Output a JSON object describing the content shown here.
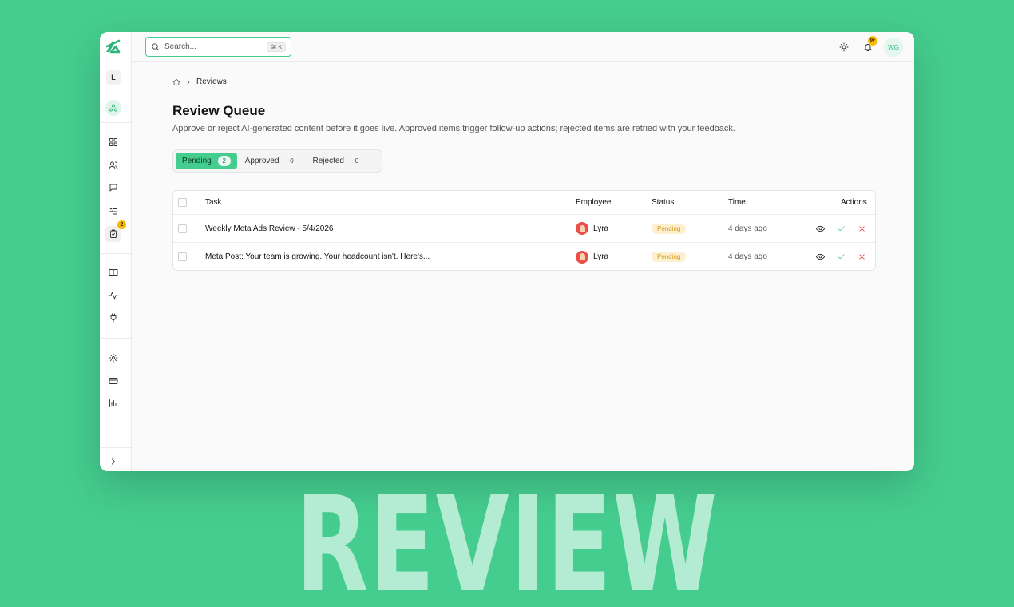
{
  "search": {
    "placeholder": "Search...",
    "shortcut": "⌘ K"
  },
  "workspace": {
    "initial": "L"
  },
  "topbar": {
    "notification_badge": "9+",
    "user_initials": "WG"
  },
  "sidebar": {
    "reviews_badge": "2",
    "icons": [
      "agents-icon",
      "dashboard-icon",
      "users-icon",
      "chat-icon",
      "tasks-icon",
      "reviews-icon",
      "book-icon",
      "activity-icon",
      "plug-icon",
      "settings-icon",
      "billing-icon",
      "analytics-icon",
      "expand-icon"
    ]
  },
  "breadcrumb": {
    "current": "Reviews"
  },
  "page": {
    "title": "Review Queue",
    "description": "Approve or reject AI-generated content before it goes live. Approved items trigger follow-up actions; rejected items are retried with your feedback."
  },
  "tabs": [
    {
      "label": "Pending",
      "count": "2"
    },
    {
      "label": "Approved",
      "count": "0"
    },
    {
      "label": "Rejected",
      "count": "0"
    }
  ],
  "table": {
    "columns": [
      "Task",
      "Employee",
      "Status",
      "Time",
      "Actions"
    ],
    "rows": [
      {
        "task": "Weekly Meta Ads Review - 5/4/2026",
        "employee": "Lyra",
        "status": "Pending",
        "time": "4 days ago"
      },
      {
        "task": "Meta Post: Your team is growing. Your headcount isn't. Here's...",
        "employee": "Lyra",
        "status": "Pending",
        "time": "4 days ago"
      }
    ]
  },
  "colors": {
    "accent": "#45cd8f",
    "pending_bg": "#fdf0cf",
    "pending_text": "#d69a1c",
    "reject": "#e23b3b"
  },
  "banner_text": "REVIEW"
}
